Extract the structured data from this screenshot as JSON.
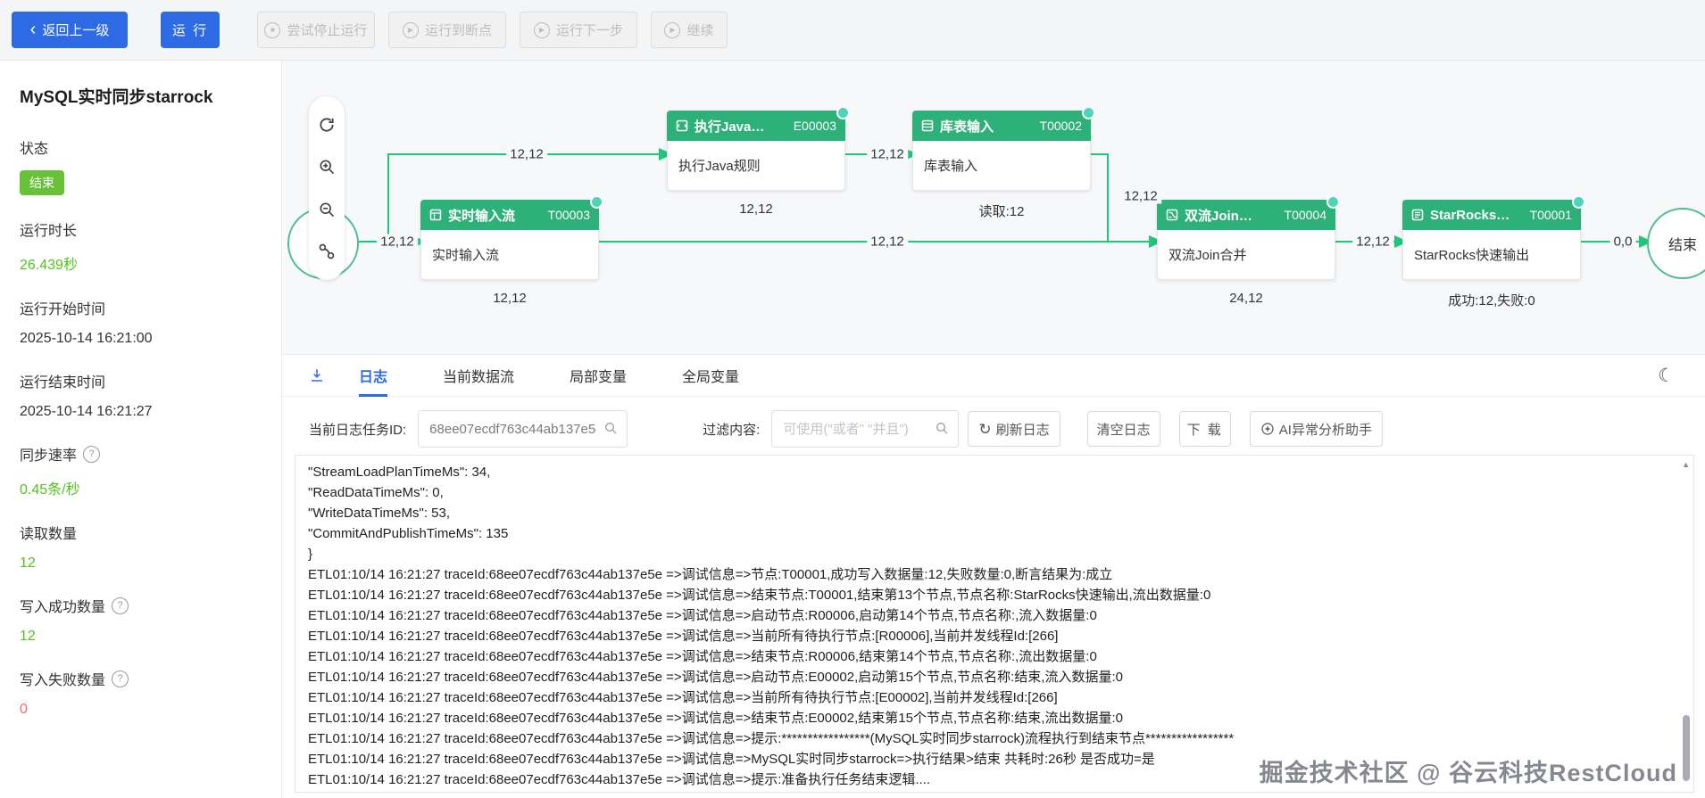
{
  "colors": {
    "primary": "#2d6ae3",
    "success": "#52c41a",
    "danger": "#f56c6c",
    "node_green": "#2eb178",
    "edge_green": "#1ec77b",
    "badge_green": "#67c23a"
  },
  "icons": {
    "back": "‹",
    "moon": "☾",
    "play": "▶",
    "stop": "■",
    "refresh": "↻",
    "help": "?",
    "scroll_up": "▲"
  },
  "topbar": {
    "back_label": "返回上一级",
    "run_label": "运 行",
    "disabled_buttons": [
      "尝试停止运行",
      "运行到断点",
      "运行下一步",
      "继续"
    ]
  },
  "sidebar": {
    "title": "MySQL实时同步starrock",
    "fields": [
      {
        "label": "状态",
        "value": "结束"
      },
      {
        "label": "运行时长",
        "value": "26.439秒"
      },
      {
        "label": "运行开始时间",
        "value": "2025-10-14 16:21:00"
      },
      {
        "label": "运行结束时间",
        "value": "2025-10-14 16:21:27"
      },
      {
        "label": "同步速率",
        "value": "0.45条/秒"
      },
      {
        "label": "读取数量",
        "value": "12"
      },
      {
        "label": "写入成功数量",
        "value": "12"
      },
      {
        "label": "写入失败数量",
        "value": "0"
      }
    ]
  },
  "canvas": {
    "end_node_label": "结束",
    "nodes": [
      {
        "name": "实时输入流",
        "code": "T00003",
        "body": "实时输入流",
        "stat": "12,12"
      },
      {
        "name": "执行Java…",
        "code": "E00003",
        "body": "执行Java规则",
        "stat": "12,12"
      },
      {
        "name": "库表输入",
        "code": "T00002",
        "body": "库表输入",
        "stat": "读取:12"
      },
      {
        "name": "双流Join…",
        "code": "T00004",
        "body": "双流Join合并",
        "stat": "24,12"
      },
      {
        "name": "StarRocks…",
        "code": "T00001",
        "body": "StarRocks快速输出",
        "stat": "成功:12,失败:0"
      }
    ],
    "edge_labels": [
      "12,12",
      "12,12",
      "12,12",
      "12,12",
      "12,12",
      "12,12",
      "0,0"
    ]
  },
  "panel": {
    "tabs": [
      "日志",
      "当前数据流",
      "局部变量",
      "全局变量"
    ],
    "active_tab": "日志",
    "task_id_label": "当前日志任务ID:",
    "task_id_value": "68ee07ecdf763c44ab137e5e",
    "filter_label": "过滤内容:",
    "filter_placeholder": "可使用(\"或者\" \"并且\")",
    "buttons": {
      "refresh": "刷新日志",
      "clear": "清空日志",
      "download": "下 载",
      "ai": "AI异常分析助手"
    },
    "log_lines": [
      "\"StreamLoadPlanTimeMs\": 34,",
      "\"ReadDataTimeMs\": 0,",
      "\"WriteDataTimeMs\": 53,",
      "\"CommitAndPublishTimeMs\": 135",
      "}",
      "ETL01:10/14 16:21:27 traceId:68ee07ecdf763c44ab137e5e =>调试信息=>节点:T00001,成功写入数据量:12,失败数量:0,断言结果为:成立",
      "ETL01:10/14 16:21:27 traceId:68ee07ecdf763c44ab137e5e =>调试信息=>结束节点:T00001,结束第13个节点,节点名称:StarRocks快速输出,流出数据量:0",
      "ETL01:10/14 16:21:27 traceId:68ee07ecdf763c44ab137e5e =>调试信息=>启动节点:R00006,启动第14个节点,节点名称:,流入数据量:0",
      "ETL01:10/14 16:21:27 traceId:68ee07ecdf763c44ab137e5e =>调试信息=>当前所有待执行节点:[R00006],当前并发线程Id:[266]",
      "ETL01:10/14 16:21:27 traceId:68ee07ecdf763c44ab137e5e =>调试信息=>结束节点:R00006,结束第14个节点,节点名称:,流出数据量:0",
      "ETL01:10/14 16:21:27 traceId:68ee07ecdf763c44ab137e5e =>调试信息=>启动节点:E00002,启动第15个节点,节点名称:结束,流入数据量:0",
      "ETL01:10/14 16:21:27 traceId:68ee07ecdf763c44ab137e5e =>调试信息=>当前所有待执行节点:[E00002],当前并发线程Id:[266]",
      "ETL01:10/14 16:21:27 traceId:68ee07ecdf763c44ab137e5e =>调试信息=>结束节点:E00002,结束第15个节点,节点名称:结束,流出数据量:0",
      "ETL01:10/14 16:21:27 traceId:68ee07ecdf763c44ab137e5e =>调试信息=>提示:*****************(MySQL实时同步starrock)流程执行到结束节点*****************",
      "ETL01:10/14 16:21:27 traceId:68ee07ecdf763c44ab137e5e =>调试信息=>MySQL实时同步starrock=>执行结果>结束 共耗时:26秒 是否成功=是",
      "ETL01:10/14 16:21:27 traceId:68ee07ecdf763c44ab137e5e =>调试信息=>提示:准备执行任务结束逻辑...."
    ],
    "watermark": "掘金技术社区 @ 谷云科技RestCloud"
  }
}
